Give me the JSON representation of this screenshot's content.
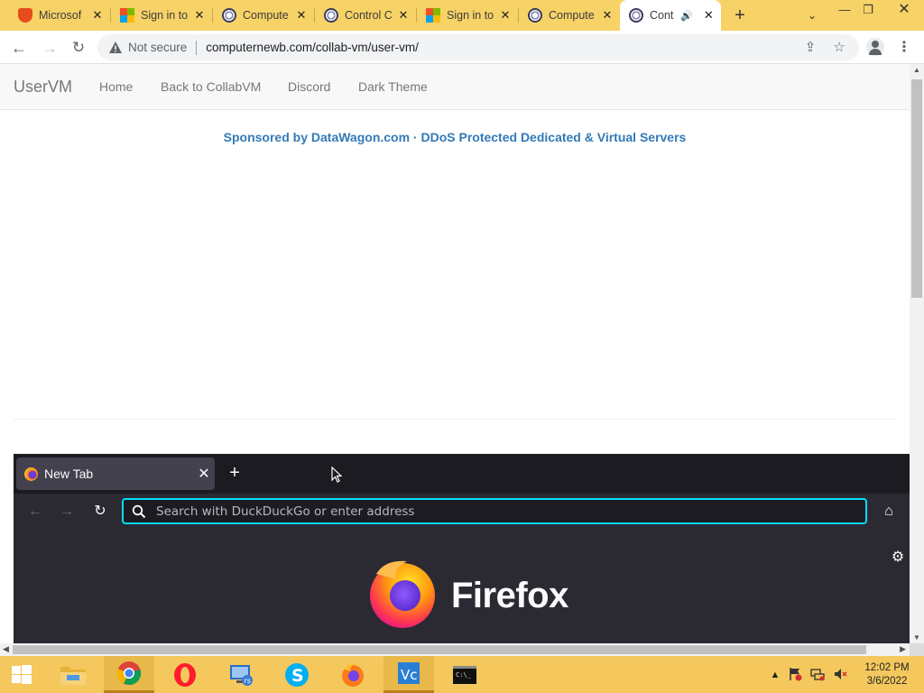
{
  "chrome": {
    "tabs": [
      {
        "title": "Microsof",
        "icon": "office-icon",
        "active": false
      },
      {
        "title": "Sign in to",
        "icon": "microsoft-icon",
        "active": false
      },
      {
        "title": "Compute",
        "icon": "collabvm-icon",
        "active": false
      },
      {
        "title": "Control C",
        "icon": "collabvm-icon",
        "active": false
      },
      {
        "title": "Sign in to",
        "icon": "microsoft-icon",
        "active": false
      },
      {
        "title": "Compute",
        "icon": "collabvm-icon",
        "active": false
      },
      {
        "title": "Cont",
        "icon": "collabvm-icon",
        "active": true,
        "audio": true
      }
    ],
    "security_label": "Not secure",
    "url": "computernewb.com/collab-vm/user-vm/"
  },
  "page": {
    "navbar": {
      "brand": "UserVM",
      "links": [
        "Home",
        "Back to CollabVM",
        "Discord",
        "Dark Theme"
      ]
    },
    "sponsor_text": "Sponsored by DataWagon.com · DDoS Protected Dedicated & Virtual Servers"
  },
  "vm_screen": {
    "firefox": {
      "tab_title": "New Tab",
      "url_placeholder": "Search with DuckDuckGo or enter address",
      "wordmark": "Firefox"
    }
  },
  "taskbar": {
    "apps": [
      "file-explorer-icon",
      "chrome-icon",
      "opera-icon",
      "remote-desktop-icon",
      "skype-icon",
      "firefox-icon",
      "visual-studio-code-icon",
      "command-prompt-icon"
    ],
    "clock": {
      "time": "12:02 PM",
      "date": "3/6/2022"
    }
  },
  "colors": {
    "accent_tabstrip": "#f7d267",
    "taskbar": "#f4c85c",
    "link_blue": "#337ab7",
    "firefox_focus": "#00ddff"
  }
}
